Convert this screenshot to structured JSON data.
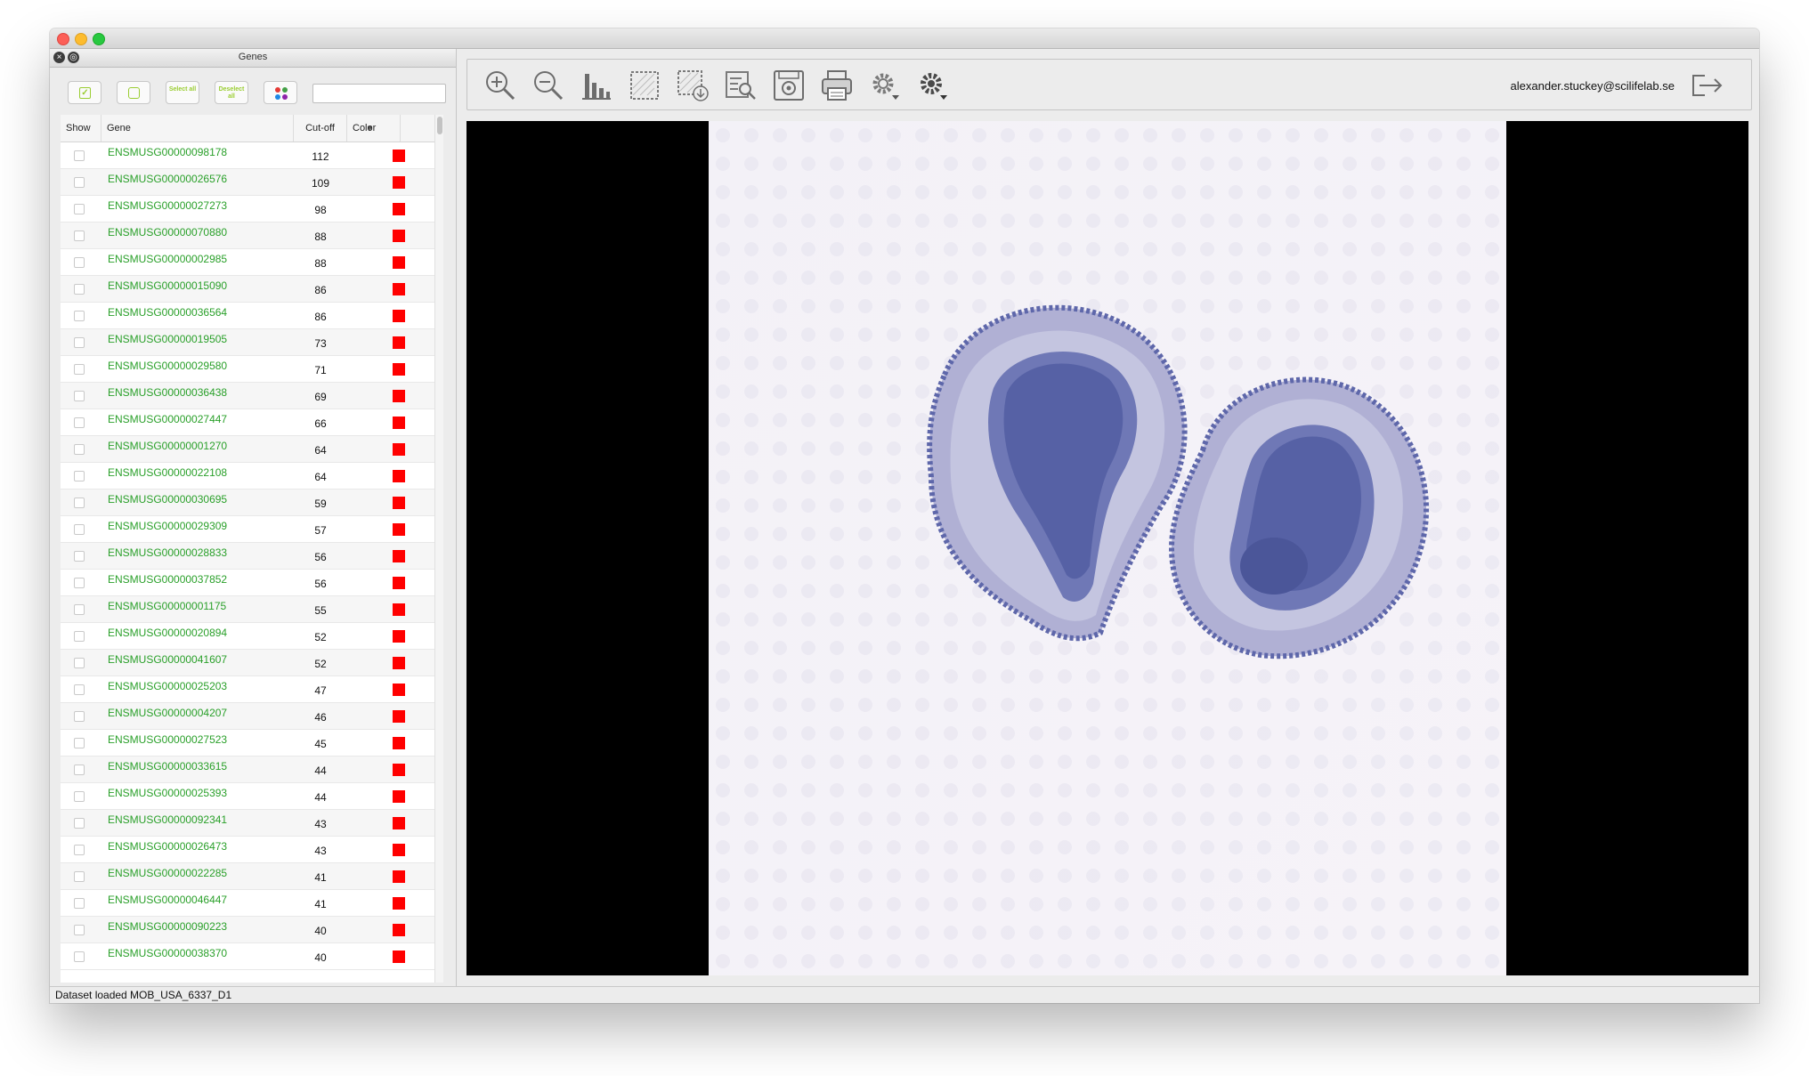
{
  "genes_panel": {
    "title": "Genes",
    "toolbar": {
      "select_all_label": "Select all",
      "deselect_all_label": "Deselect all"
    },
    "search": {
      "value": ""
    },
    "columns": {
      "show": "Show",
      "gene": "Gene",
      "cutoff": "Cut-off",
      "color": "Color"
    },
    "rows": [
      {
        "gene": "ENSMUSG00000098178",
        "cutoff": "112"
      },
      {
        "gene": "ENSMUSG00000026576",
        "cutoff": "109"
      },
      {
        "gene": "ENSMUSG00000027273",
        "cutoff": "98"
      },
      {
        "gene": "ENSMUSG00000070880",
        "cutoff": "88"
      },
      {
        "gene": "ENSMUSG00000002985",
        "cutoff": "88"
      },
      {
        "gene": "ENSMUSG00000015090",
        "cutoff": "86"
      },
      {
        "gene": "ENSMUSG00000036564",
        "cutoff": "86"
      },
      {
        "gene": "ENSMUSG00000019505",
        "cutoff": "73"
      },
      {
        "gene": "ENSMUSG00000029580",
        "cutoff": "71"
      },
      {
        "gene": "ENSMUSG00000036438",
        "cutoff": "69"
      },
      {
        "gene": "ENSMUSG00000027447",
        "cutoff": "66"
      },
      {
        "gene": "ENSMUSG00000001270",
        "cutoff": "64"
      },
      {
        "gene": "ENSMUSG00000022108",
        "cutoff": "64"
      },
      {
        "gene": "ENSMUSG00000030695",
        "cutoff": "59"
      },
      {
        "gene": "ENSMUSG00000029309",
        "cutoff": "57"
      },
      {
        "gene": "ENSMUSG00000028833",
        "cutoff": "56"
      },
      {
        "gene": "ENSMUSG00000037852",
        "cutoff": "56"
      },
      {
        "gene": "ENSMUSG00000001175",
        "cutoff": "55"
      },
      {
        "gene": "ENSMUSG00000020894",
        "cutoff": "52"
      },
      {
        "gene": "ENSMUSG00000041607",
        "cutoff": "52"
      },
      {
        "gene": "ENSMUSG00000025203",
        "cutoff": "47"
      },
      {
        "gene": "ENSMUSG00000004207",
        "cutoff": "46"
      },
      {
        "gene": "ENSMUSG00000027523",
        "cutoff": "45"
      },
      {
        "gene": "ENSMUSG00000033615",
        "cutoff": "44"
      },
      {
        "gene": "ENSMUSG00000025393",
        "cutoff": "44"
      },
      {
        "gene": "ENSMUSG00000092341",
        "cutoff": "43"
      },
      {
        "gene": "ENSMUSG00000026473",
        "cutoff": "43"
      },
      {
        "gene": "ENSMUSG00000022285",
        "cutoff": "41"
      },
      {
        "gene": "ENSMUSG00000046447",
        "cutoff": "41"
      },
      {
        "gene": "ENSMUSG00000090223",
        "cutoff": "40"
      },
      {
        "gene": "ENSMUSG00000038370",
        "cutoff": "40"
      }
    ]
  },
  "colors": {
    "gene_name": "#2aa02a",
    "gene_swatch": "#ff0000",
    "tool_accent": "#9acd32"
  },
  "main_toolbar": {
    "icons": [
      "zoom-in-icon",
      "zoom-out-icon",
      "bar-chart-icon",
      "selection-icon",
      "export-selection-icon",
      "inspect-selection-icon",
      "screenshot-icon",
      "print-icon",
      "cell-settings-icon",
      "settings-icon"
    ],
    "user_email": "alexander.stuckey@scilifelab.se"
  },
  "status": {
    "text": "Dataset loaded MOB_USA_6337_D1"
  }
}
